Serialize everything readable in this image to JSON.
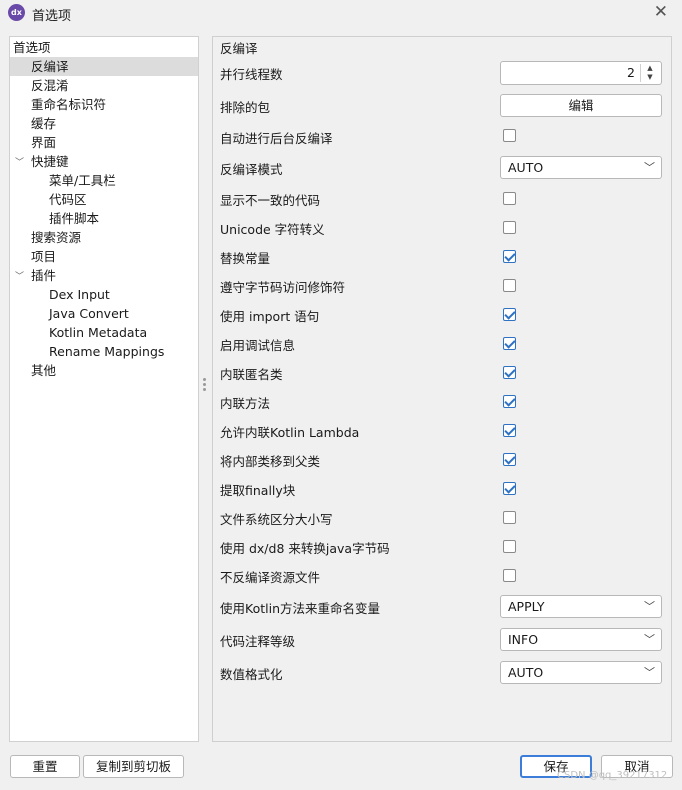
{
  "window": {
    "title": "首选项",
    "app_icon_text": "dx"
  },
  "tree": {
    "root": "首选项",
    "items": [
      {
        "label": "反编译",
        "selected": true
      },
      {
        "label": "反混淆"
      },
      {
        "label": "重命名标识符"
      },
      {
        "label": "缓存"
      },
      {
        "label": "界面"
      },
      {
        "label": "快捷键",
        "expanded": true
      },
      {
        "label": "菜单/工具栏"
      },
      {
        "label": "代码区"
      },
      {
        "label": "插件脚本"
      },
      {
        "label": "搜索资源"
      },
      {
        "label": "项目"
      },
      {
        "label": "插件",
        "expanded": true
      },
      {
        "label": "Dex Input"
      },
      {
        "label": "Java Convert"
      },
      {
        "label": "Kotlin Metadata"
      },
      {
        "label": "Rename Mappings"
      },
      {
        "label": "其他"
      }
    ]
  },
  "panel": {
    "title": "反编译",
    "thread_count": {
      "label": "并行线程数",
      "value": "2"
    },
    "excluded_packages": {
      "label": "排除的包",
      "button": "编辑"
    },
    "auto_bg": {
      "label": "自动进行后台反编译",
      "checked": false
    },
    "mode": {
      "label": "反编译模式",
      "value": "AUTO"
    },
    "show_inconsistent": {
      "label": "显示不一致的代码",
      "checked": false
    },
    "unicode_escape": {
      "label": "Unicode 字符转义",
      "checked": false
    },
    "replace_consts": {
      "label": "替换常量",
      "checked": true
    },
    "respect_access": {
      "label": "遵守字节码访问修饰符",
      "checked": false
    },
    "use_imports": {
      "label": "使用 import 语句",
      "checked": true
    },
    "debug_info": {
      "label": "启用调试信息",
      "checked": true
    },
    "inline_anon": {
      "label": "内联匿名类",
      "checked": true
    },
    "inline_methods": {
      "label": "内联方法",
      "checked": true
    },
    "inline_kotlin_lambda": {
      "label": "允许内联Kotlin Lambda",
      "checked": true
    },
    "move_inner": {
      "label": "将内部类移到父类",
      "checked": true
    },
    "extract_finally": {
      "label": "提取finally块",
      "checked": true
    },
    "fs_case": {
      "label": "文件系统区分大小写",
      "checked": false
    },
    "use_dx": {
      "label": "使用 dx/d8 来转换java字节码",
      "checked": false
    },
    "skip_resources": {
      "label": "不反编译资源文件",
      "checked": false
    },
    "kotlin_rename": {
      "label": "使用Kotlin方法来重命名变量",
      "value": "APPLY"
    },
    "comments_level": {
      "label": "代码注释等级",
      "value": "INFO"
    },
    "integer_format": {
      "label": "数值格式化",
      "value": "AUTO"
    }
  },
  "footer": {
    "reset": "重置",
    "copy": "复制到剪切板",
    "save": "保存",
    "cancel": "取消"
  },
  "watermark": "CSDN @qq_39217312",
  "colors": {
    "accent": "#3b7dd8",
    "check": "#2f72c4",
    "selection": "#dcdcdc"
  }
}
